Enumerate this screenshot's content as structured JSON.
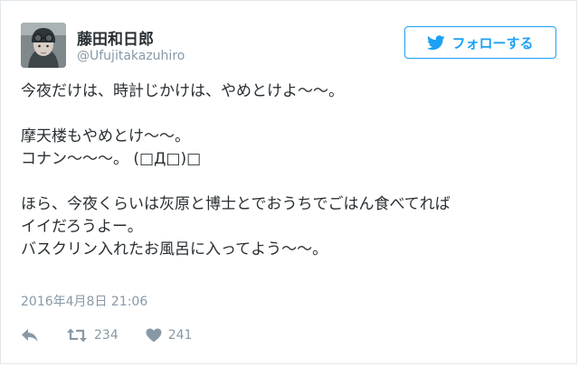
{
  "user": {
    "name": "藤田和日郎",
    "handle": "@Ufujitakazuhiro"
  },
  "follow": {
    "label": "フォローする",
    "icon": "twitter-bird-icon",
    "color": "#1da1f2"
  },
  "tweet": {
    "lines": [
      "今夜だけは、時計じかけは、やめとけよ〜〜。",
      "",
      "摩天楼もやめとけ〜〜。",
      "コナン〜〜〜。 (□Д□)□",
      "",
      "ほら、今夜くらいは灰原と博士とでおうちでごはん食べてれば",
      "イイだろうよー。",
      "バスクリン入れたお風呂に入ってよう〜〜。"
    ],
    "timestamp": "2016年4月8日 21:06"
  },
  "actions": {
    "reply_icon": "reply-icon",
    "retweet_icon": "retweet-icon",
    "retweet_count": "234",
    "like_icon": "heart-icon",
    "like_count": "241"
  }
}
